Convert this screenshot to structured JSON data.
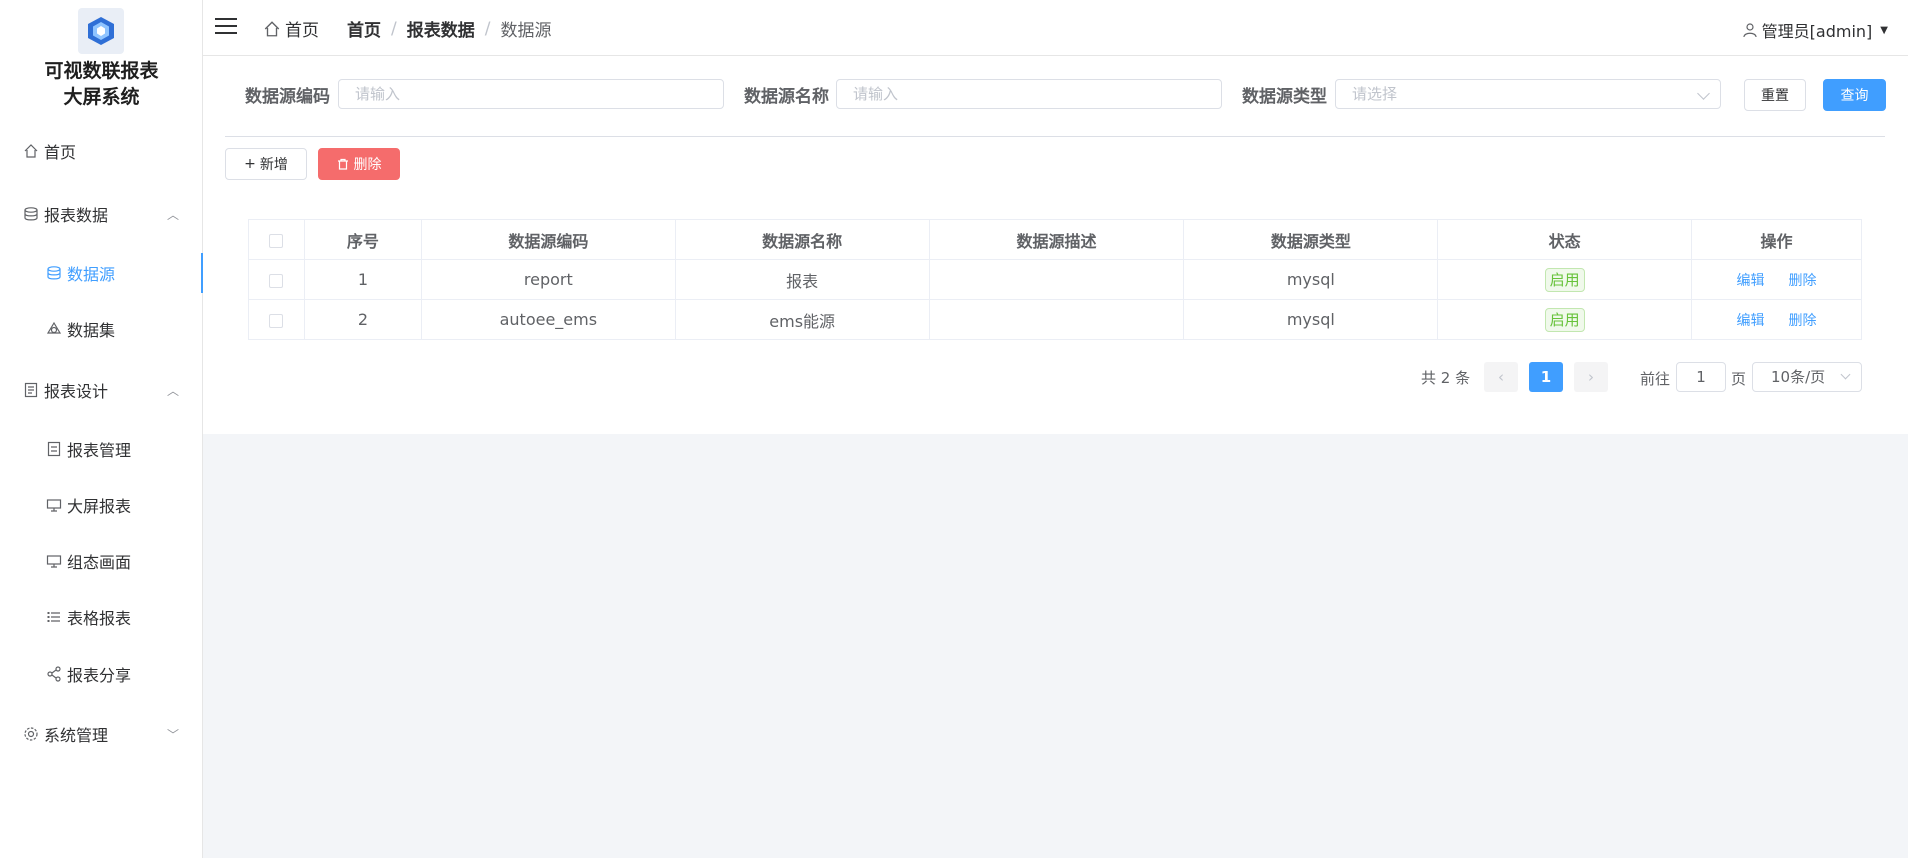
{
  "app": {
    "title_line1": "可视数联报表",
    "title_line2": "大屏系统"
  },
  "sidebar": {
    "items": [
      {
        "label": "首页"
      },
      {
        "label": "报表数据"
      },
      {
        "label": "数据源"
      },
      {
        "label": "数据集"
      },
      {
        "label": "报表设计"
      },
      {
        "label": "报表管理"
      },
      {
        "label": "大屏报表"
      },
      {
        "label": "组态画面"
      },
      {
        "label": "表格报表"
      },
      {
        "label": "报表分享"
      },
      {
        "label": "系统管理"
      }
    ]
  },
  "header": {
    "home": "首页",
    "breadcrumb": [
      "首页",
      "报表数据",
      "数据源"
    ],
    "user": "管理员[admin]"
  },
  "search": {
    "code_label": "数据源编码",
    "code_placeholder": "请输入",
    "name_label": "数据源名称",
    "name_placeholder": "请输入",
    "type_label": "数据源类型",
    "type_placeholder": "请选择",
    "reset": "重置",
    "query": "查询"
  },
  "toolbar": {
    "add": "新增",
    "delete": "删除"
  },
  "table": {
    "columns": [
      "序号",
      "数据源编码",
      "数据源名称",
      "数据源描述",
      "数据源类型",
      "状态",
      "操作"
    ],
    "rows": [
      {
        "no": "1",
        "code": "report",
        "name": "报表",
        "desc": "",
        "type": "mysql",
        "status": "启用"
      },
      {
        "no": "2",
        "code": "autoee_ems",
        "name": "ems能源",
        "desc": "",
        "type": "mysql",
        "status": "启用"
      }
    ],
    "edit": "编辑",
    "remove": "删除"
  },
  "pagination": {
    "total": "共 2 条",
    "current": "1",
    "goto_prefix": "前往",
    "goto_value": "1",
    "goto_suffix": "页",
    "page_size": "10条/页"
  },
  "colors": {
    "primary": "#409eff",
    "danger": "#f56c6c",
    "success": "#67c23a"
  }
}
